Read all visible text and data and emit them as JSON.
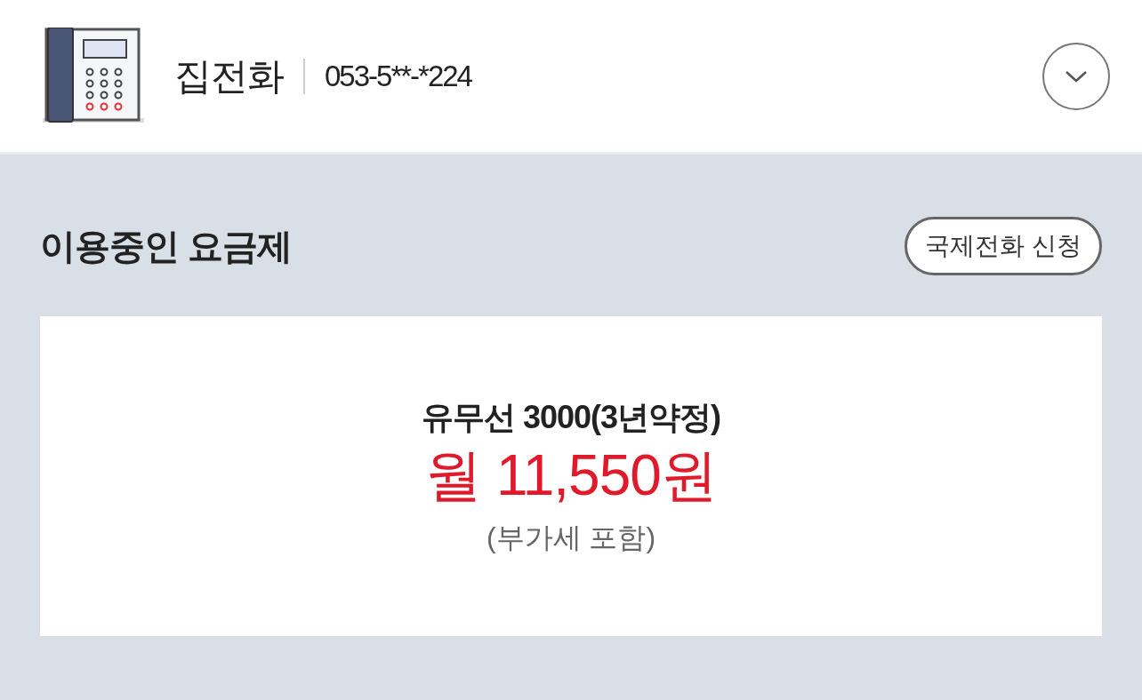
{
  "line": {
    "title": "집전화",
    "number": "053-5**-*224",
    "expanded": false
  },
  "plan_section": {
    "title": "이용중인 요금제",
    "action": "국제전화 신청"
  },
  "plan": {
    "name": "유무선 3000(3년약정)",
    "price": "월 11,550원",
    "note": "(부가세 포함)"
  }
}
